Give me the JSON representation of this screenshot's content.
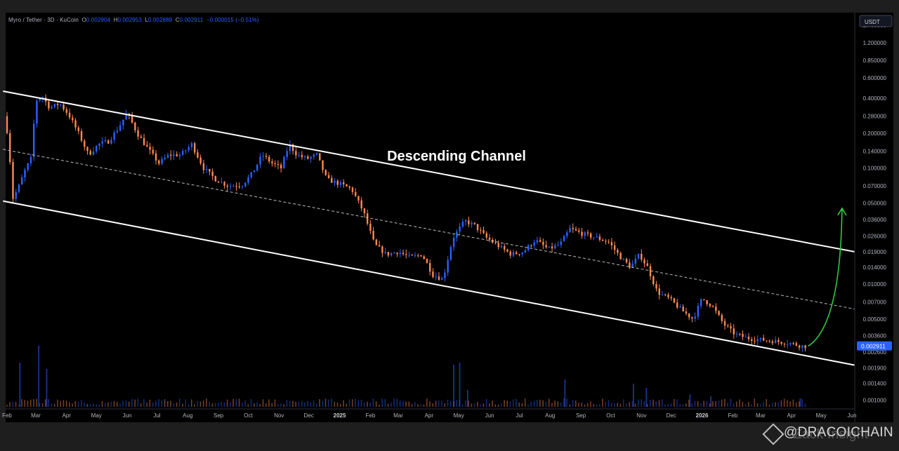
{
  "header": {
    "symbol": "Myro / Tether · 3D · KuCoin",
    "o_label": "O",
    "o_value": "0.002904",
    "h_label": "H",
    "h_value": "0.002953",
    "l_label": "L",
    "l_value": "0.002889",
    "c_label": "C",
    "c_value": "0.002911",
    "change": "−0.000015 (−0.51%)"
  },
  "currency_badge": "USDT",
  "last_price_badge": "0.002911",
  "watermark": {
    "text": "@DRACOICHAIN",
    "overlay_text": "Zack Insight"
  },
  "colors": {
    "up": "#2962ff",
    "down": "#ff8a50",
    "channel": "#ffffff",
    "arrow": "#2ecc40",
    "background": "#000000"
  },
  "chart_data": {
    "type": "candlestick",
    "title": "",
    "annotation": "Descending Channel",
    "scale": "log",
    "ylim": [
      0.0009,
      1.85
    ],
    "y_ticks": [
      {
        "value": 1.7,
        "label": "1.700000"
      },
      {
        "value": 1.2,
        "label": "1.200000"
      },
      {
        "value": 0.85,
        "label": "0.850000"
      },
      {
        "value": 0.6,
        "label": "0.600000"
      },
      {
        "value": 0.4,
        "label": "0.400000"
      },
      {
        "value": 0.28,
        "label": "0.280000"
      },
      {
        "value": 0.2,
        "label": "0.200000"
      },
      {
        "value": 0.14,
        "label": "0.140000"
      },
      {
        "value": 0.1,
        "label": "0.100000"
      },
      {
        "value": 0.07,
        "label": "0.070000"
      },
      {
        "value": 0.05,
        "label": "0.050000"
      },
      {
        "value": 0.036,
        "label": "0.036000"
      },
      {
        "value": 0.026,
        "label": "0.026000"
      },
      {
        "value": 0.019,
        "label": "0.019000"
      },
      {
        "value": 0.014,
        "label": "0.014000"
      },
      {
        "value": 0.01,
        "label": "0.010000"
      },
      {
        "value": 0.007,
        "label": "0.007000"
      },
      {
        "value": 0.005,
        "label": "0.005000"
      },
      {
        "value": 0.0036,
        "label": "0.003600"
      },
      {
        "value": 0.0026,
        "label": "0.002600"
      },
      {
        "value": 0.0019,
        "label": "0.001900"
      },
      {
        "value": 0.0014,
        "label": "0.001400"
      },
      {
        "value": 0.001,
        "label": "0.001000"
      }
    ],
    "x_ticks": [
      "Feb",
      "Mar",
      "Apr",
      "May",
      "Jun",
      "Jul",
      "Aug",
      "Sep",
      "Oct",
      "Nov",
      "Dec",
      "2025",
      "Feb",
      "Mar",
      "Apr",
      "May",
      "Jun",
      "Jul",
      "Aug",
      "Sep",
      "Oct",
      "Nov",
      "Dec",
      "2026",
      "Feb",
      "Mar",
      "Apr",
      "May",
      "Jun"
    ],
    "x_start": "2024-02-01",
    "x_end": "2026-06-01",
    "price_path": [
      [
        "2024-02-01",
        0.28
      ],
      [
        "2024-02-05",
        0.19
      ],
      [
        "2024-02-10",
        0.055
      ],
      [
        "2024-02-16",
        0.07
      ],
      [
        "2024-02-22",
        0.095
      ],
      [
        "2024-02-28",
        0.12
      ],
      [
        "2024-03-04",
        0.38
      ],
      [
        "2024-03-10",
        0.42
      ],
      [
        "2024-03-18",
        0.33
      ],
      [
        "2024-03-28",
        0.36
      ],
      [
        "2024-04-06",
        0.29
      ],
      [
        "2024-04-16",
        0.2
      ],
      [
        "2024-04-26",
        0.13
      ],
      [
        "2024-05-06",
        0.16
      ],
      [
        "2024-05-16",
        0.17
      ],
      [
        "2024-05-26",
        0.22
      ],
      [
        "2024-06-04",
        0.3
      ],
      [
        "2024-06-14",
        0.2
      ],
      [
        "2024-06-24",
        0.15
      ],
      [
        "2024-07-06",
        0.11
      ],
      [
        "2024-07-16",
        0.13
      ],
      [
        "2024-07-28",
        0.13
      ],
      [
        "2024-08-08",
        0.16
      ],
      [
        "2024-08-20",
        0.1
      ],
      [
        "2024-09-01",
        0.08
      ],
      [
        "2024-09-14",
        0.07
      ],
      [
        "2024-09-28",
        0.072
      ],
      [
        "2024-10-08",
        0.09
      ],
      [
        "2024-10-18",
        0.13
      ],
      [
        "2024-10-28",
        0.11
      ],
      [
        "2024-11-06",
        0.1
      ],
      [
        "2024-11-14",
        0.16
      ],
      [
        "2024-11-22",
        0.13
      ],
      [
        "2024-12-02",
        0.12
      ],
      [
        "2024-12-12",
        0.13
      ],
      [
        "2024-12-22",
        0.08
      ],
      [
        "2025-01-04",
        0.073
      ],
      [
        "2025-01-16",
        0.066
      ],
      [
        "2025-01-28",
        0.042
      ],
      [
        "2025-02-08",
        0.022
      ],
      [
        "2025-02-20",
        0.018
      ],
      [
        "2025-03-04",
        0.019
      ],
      [
        "2025-03-16",
        0.017
      ],
      [
        "2025-03-28",
        0.018
      ],
      [
        "2025-04-08",
        0.012
      ],
      [
        "2025-04-18",
        0.011
      ],
      [
        "2025-04-28",
        0.025
      ],
      [
        "2025-05-10",
        0.035
      ],
      [
        "2025-05-20",
        0.032
      ],
      [
        "2025-06-01",
        0.025
      ],
      [
        "2025-06-14",
        0.021
      ],
      [
        "2025-06-26",
        0.018
      ],
      [
        "2025-07-08",
        0.019
      ],
      [
        "2025-07-20",
        0.024
      ],
      [
        "2025-08-02",
        0.02
      ],
      [
        "2025-08-14",
        0.022
      ],
      [
        "2025-08-24",
        0.03
      ],
      [
        "2025-09-06",
        0.027
      ],
      [
        "2025-09-20",
        0.025
      ],
      [
        "2025-10-02",
        0.023
      ],
      [
        "2025-10-14",
        0.017
      ],
      [
        "2025-10-24",
        0.014
      ],
      [
        "2025-11-02",
        0.018
      ],
      [
        "2025-11-10",
        0.014
      ],
      [
        "2025-11-20",
        0.0085
      ],
      [
        "2025-12-02",
        0.0075
      ],
      [
        "2025-12-14",
        0.006
      ],
      [
        "2025-12-26",
        0.005
      ],
      [
        "2026-01-04",
        0.0075
      ],
      [
        "2026-01-14",
        0.0065
      ],
      [
        "2026-01-26",
        0.0045
      ],
      [
        "2026-02-06",
        0.0037
      ],
      [
        "2026-02-20",
        0.0034
      ],
      [
        "2026-03-06",
        0.0033
      ],
      [
        "2026-03-20",
        0.0032
      ],
      [
        "2026-04-02",
        0.0031
      ],
      [
        "2026-04-16",
        0.00291
      ]
    ],
    "channel": {
      "upper": [
        [
          "2024-01-28",
          0.46
        ],
        [
          "2026-06-08",
          0.0187
        ]
      ],
      "mid": [
        [
          "2024-01-28",
          0.145
        ],
        [
          "2026-06-08",
          0.006
        ]
      ],
      "lower": [
        [
          "2024-01-28",
          0.052
        ],
        [
          "2026-06-08",
          0.00197
        ]
      ]
    },
    "projection_arrow": {
      "from": [
        "2026-04-18",
        0.00292
      ],
      "to": [
        "2026-05-22",
        0.045
      ]
    },
    "volume_spikes": [
      [
        "2024-02-14",
        0.42
      ],
      [
        "2024-03-04",
        0.58
      ],
      [
        "2024-03-12",
        0.36
      ],
      [
        "2025-04-26",
        0.4
      ],
      [
        "2025-05-02",
        0.42
      ],
      [
        "2025-05-10",
        0.16
      ],
      [
        "2025-08-16",
        0.26
      ],
      [
        "2025-10-24",
        0.22
      ],
      [
        "2025-11-06",
        0.18
      ],
      [
        "2025-12-20",
        0.12
      ],
      [
        "2026-01-10",
        0.1
      ],
      [
        "2026-04-10",
        0.08
      ]
    ],
    "grid": false,
    "legend": "none"
  }
}
